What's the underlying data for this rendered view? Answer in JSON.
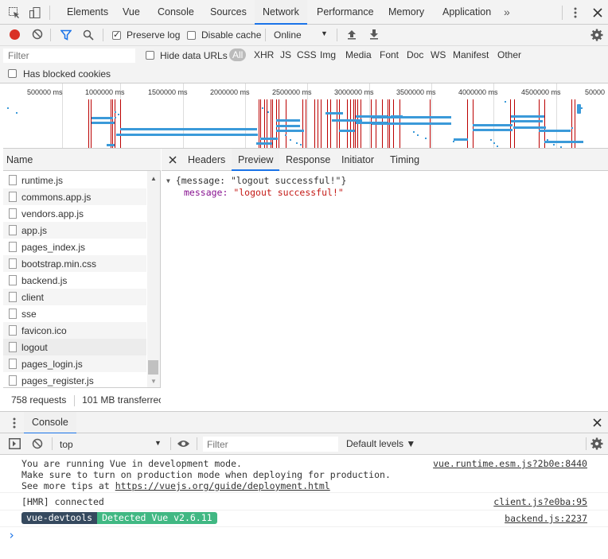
{
  "tabbar": {
    "tabs": [
      "Elements",
      "Vue",
      "Console",
      "Sources",
      "Network",
      "Performance",
      "Memory",
      "Application"
    ],
    "active": "Network",
    "more": "»"
  },
  "toolbar": {
    "preserve_log": "Preserve log",
    "disable_cache": "Disable cache",
    "throttle": "Online"
  },
  "filterbar": {
    "filter_placeholder": "Filter",
    "hide_data_urls": "Hide data URLs",
    "types": [
      "All",
      "XHR",
      "JS",
      "CSS",
      "Img",
      "Media",
      "Font",
      "Doc",
      "WS",
      "Manifest",
      "Other"
    ],
    "has_blocked_cookies": "Has blocked cookies"
  },
  "overview": {
    "ticks": [
      "500000 ms",
      "1000000 ms",
      "1500000 ms",
      "2000000 ms",
      "2500000 ms",
      "3000000 ms",
      "3500000 ms",
      "4000000 ms",
      "4500000 ms",
      "50000"
    ]
  },
  "requests": {
    "header": "Name",
    "items": [
      "runtime.js",
      "commons.app.js",
      "vendors.app.js",
      "app.js",
      "pages_index.js",
      "bootstrap.min.css",
      "backend.js",
      "client",
      "sse",
      "favicon.ico",
      "logout",
      "pages_login.js",
      "pages_register.js"
    ],
    "selected": "logout",
    "summary_requests": "758 requests",
    "summary_transferred": "101 MB transferrec"
  },
  "detail": {
    "tabs": [
      "Headers",
      "Preview",
      "Response",
      "Initiator",
      "Timing"
    ],
    "active": "Preview",
    "preview_root": "{message: \"logout successful!\"}",
    "preview_key": "message:",
    "preview_value": "\"logout successful!\""
  },
  "drawer": {
    "tab": "Console"
  },
  "console_toolbar": {
    "context": "top",
    "filter_placeholder": "Filter",
    "levels": "Default levels ▼"
  },
  "console": {
    "msg1_line1": "You are running Vue in development mode.",
    "msg1_line2": "Make sure to turn on production mode when deploying for production.",
    "msg1_line3_prefix": "See more tips at ",
    "msg1_line3_link": "https://vuejs.org/guide/deployment.html",
    "msg1_src": "vue.runtime.esm.js?2b0e:8440",
    "msg2": "[HMR] connected",
    "msg2_src": "client.js?e0ba:95",
    "badge1": "vue-devtools",
    "badge2": "Detected Vue v2.6.11",
    "msg3_src": "backend.js:2237",
    "prompt": "›"
  },
  "colors": {
    "accent": "#1a73e8",
    "record_red": "#d93025",
    "badge_dark": "#35495e",
    "badge_green": "#41b883",
    "preview_key": "#881391",
    "preview_string": "#c41a16"
  }
}
